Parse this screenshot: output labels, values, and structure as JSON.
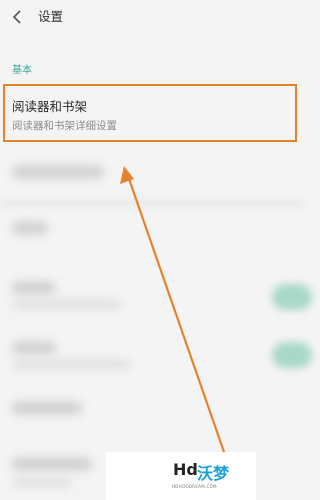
{
  "header": {
    "title": "设置",
    "back_icon": "chevron-left-icon"
  },
  "section": {
    "label": "基本"
  },
  "highlighted_item": {
    "title": "阅读器和书架",
    "subtitle": "阅读器和书架详细设置"
  },
  "colors": {
    "accent": "#3aa796",
    "highlight_border": "#e5822c",
    "arrow": "#e5822c",
    "background": "#f4f4f4"
  },
  "watermark": {
    "brand_latin": "Hd",
    "brand_cn": "沃梦",
    "domain": "HDHOODREAM.COM"
  }
}
